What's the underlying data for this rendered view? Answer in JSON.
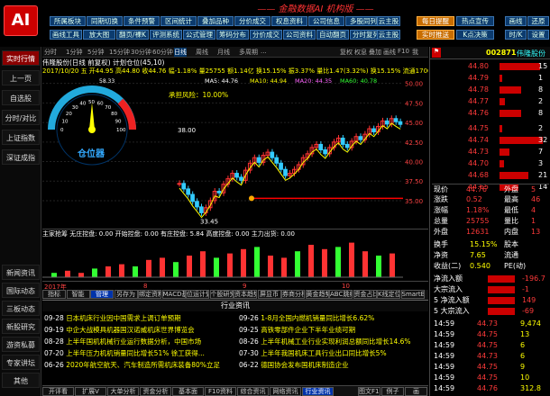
{
  "app": {
    "logo": "AI",
    "title": "—— 金融数据AI 机构版 ——"
  },
  "toolbar": {
    "row1": [
      "所属板块",
      "同期切换",
      "条件预警",
      "区间统计",
      "叠加品种",
      "分价成交",
      "权息资料",
      "公司信息",
      "多股同列"
    ],
    "row2": [
      "画线工具",
      "放大图",
      "翻页/裸K",
      "评测系统",
      "公式管理",
      "筹码分布",
      "分价成交",
      "公司资料",
      "自动翻页",
      "分时复列"
    ],
    "right1": [
      "云主股",
      "每日提醒",
      "热点宣传"
    ],
    "right2": [
      "云主股",
      "实时推送",
      "K点决策"
    ],
    "far": [
      "画线",
      "还原",
      "时/K",
      "设置"
    ]
  },
  "sidebar": [
    "实时行情",
    "上一页",
    "自选股",
    "分时/对比",
    "上证指数",
    "深证成指",
    "新闻资讯",
    "国际动态",
    "三板动态",
    "新股研究",
    "游资私募",
    "专家讲坛",
    "其他"
  ],
  "period_tabs": [
    "分时",
    "1分钟",
    "5分钟",
    "15分钟",
    "30分钟",
    "60分钟",
    "日线",
    "周线",
    "月线",
    "多周期",
    "..."
  ],
  "period_right": [
    "复权",
    "权息",
    "叠加",
    "画线",
    "F10",
    "我"
  ],
  "info": {
    "line": "伟隆股份(日线 前复权) 计划仓位(45,10)",
    "line2": "2017/10/20 五 开44.95 高44.80 收44.76 幅-1.18% 量25755 额1.14亿 换15.15% 振3.37% 量比1.47(3.32%) 换15.15% 流通1700万 机",
    "risk": "承担风险：10.00%",
    "gauge": "仓位器",
    "gauge_val": "58.33"
  },
  "chart_data": {
    "type": "line",
    "title": "伟隆股份",
    "y_ticks": [
      "50.00",
      "47.50",
      "45.00",
      "42.50",
      "40.00",
      "37.50",
      "35.00"
    ],
    "x_ticks": [
      "2017年",
      "8",
      "9",
      "10"
    ],
    "price_labels": [
      "33.45",
      "38.00"
    ],
    "ma": [
      "MA5: 44.76",
      "MA10: 44.94",
      "MA20: 44.35",
      "MA60: 40.78"
    ],
    "y": [
      37.2,
      36.5,
      35.8,
      34.9,
      34.2,
      33.45,
      34.1,
      35.0,
      36.2,
      36.0,
      37.1,
      37.8,
      38.5,
      38.0,
      37.6,
      38.9,
      39.8,
      40.5,
      39.9,
      40.8,
      41.2,
      40.5,
      39.8,
      39.0,
      38.2,
      38.5,
      39.0,
      39.6,
      40.5,
      41.0,
      41.8,
      42.2,
      41.5,
      41.0,
      41.8,
      42.5,
      43.0,
      42.2,
      41.8,
      42.6,
      43.2,
      42.8,
      43.5,
      44.2,
      43.8,
      44.5,
      45.2,
      44.8,
      45.5,
      45.1,
      44.76
    ]
  },
  "indicator": {
    "row": "主家抢筹 无庄控盘: 0.00 开始控盘: 0.00 有庄控盘: 5.84 高度控盘: 0.00 主力出货: 0.00",
    "vals": [
      2,
      3,
      2,
      4,
      5,
      6,
      5,
      8,
      9,
      7,
      10,
      12,
      9,
      11,
      13,
      14,
      10,
      9,
      12,
      15,
      13,
      14,
      16,
      12,
      10,
      11
    ]
  },
  "tool_tabs": [
    "指标",
    "智能",
    "管理",
    "另存为",
    "绑定资料",
    "MACD基本",
    "位运计划",
    "个股研究",
    "资本趋势",
    "屏显币",
    "券商分析",
    "黄金趋势",
    "ABC跳线",
    "资金占比",
    "K线定位",
    "SmartBS"
  ],
  "news": {
    "header": "行业资讯",
    "left": [
      {
        "d": "09-28",
        "t": "日本机床行业因中国需求上调订单预期"
      },
      {
        "d": "09-19",
        "t": "中企大战模具机器国汉诺威机床世界博览会"
      },
      {
        "d": "08-28",
        "t": "上半年国机机械行业运行数据分析，中国市场"
      },
      {
        "d": "07-20",
        "t": "上半年压力机机销量同比增长51% 徐工获得..."
      },
      {
        "d": "06-26",
        "t": "2020年航空航天、汽车制造所需机床装备80%立足"
      }
    ],
    "right": [
      {
        "d": "09-26",
        "t": "1-8月全国内燃机销量同比增长6.62%"
      },
      {
        "d": "09-25",
        "t": "高铁零部件企业下半年业绩可期"
      },
      {
        "d": "08-26",
        "t": "上半年机械工业行业实现利润总额同比增长14.6%"
      },
      {
        "d": "07-30",
        "t": "上半年我国机床工具行业出口同比增长5%"
      },
      {
        "d": "06-22",
        "t": "德国协会发布国机床制造企业"
      }
    ]
  },
  "bottom_tabs": [
    "开评看",
    "扩展V",
    "大单分析",
    "资金分析",
    "基本面",
    "F10资料",
    "综合资讯",
    "网络资讯",
    "行业资讯"
  ],
  "bottom_right": [
    "图文F10",
    "例子",
    "画"
  ],
  "rp": {
    "code": "002871",
    "name": "伟隆股份",
    "asks": [
      [
        "44.80",
        "15"
      ],
      [
        "44.79",
        "1"
      ],
      [
        "44.78",
        "8"
      ],
      [
        "44.77",
        "2"
      ],
      [
        "44.76",
        "8"
      ]
    ],
    "bids": [
      [
        "44.75",
        "2"
      ],
      [
        "44.74",
        "32"
      ],
      [
        "44.73",
        "7"
      ],
      [
        "44.70",
        "3"
      ],
      [
        "44.68",
        "21"
      ],
      [
        "44.65",
        "14"
      ]
    ],
    "stats": [
      [
        "现价",
        "44.76",
        "外盘",
        "5"
      ],
      [
        "涨跌",
        "0.52",
        "最高",
        "46"
      ],
      [
        "涨幅",
        "1.18%",
        "最低",
        "4"
      ],
      [
        "总量",
        "25755",
        "量比",
        "1"
      ],
      [
        "外盘",
        "12631",
        "内盘",
        "13"
      ]
    ],
    "stats2": [
      [
        "换手",
        "15.15%",
        "股本",
        ""
      ],
      [
        "净资",
        "7.65",
        "流通",
        ""
      ],
      [
        "收益(二)",
        "0.540",
        "PE(动)",
        ""
      ]
    ],
    "flow": [
      [
        "净流入额",
        "-196.7"
      ],
      [
        "大宗流入",
        "-1"
      ],
      [
        "5 净流入额",
        "149"
      ],
      [
        "5 大宗流入",
        "-69"
      ]
    ],
    "ticks": [
      [
        "14:59",
        "44.73",
        "9,474"
      ],
      [
        "14:59",
        "44.75",
        "13"
      ],
      [
        "14:59",
        "44.75",
        "6"
      ],
      [
        "14:59",
        "44.73",
        "6"
      ],
      [
        "14:59",
        "44.75",
        "9"
      ],
      [
        "14:59",
        "44.75",
        "10"
      ],
      [
        "14:59",
        "44.76",
        "312.8"
      ]
    ]
  }
}
